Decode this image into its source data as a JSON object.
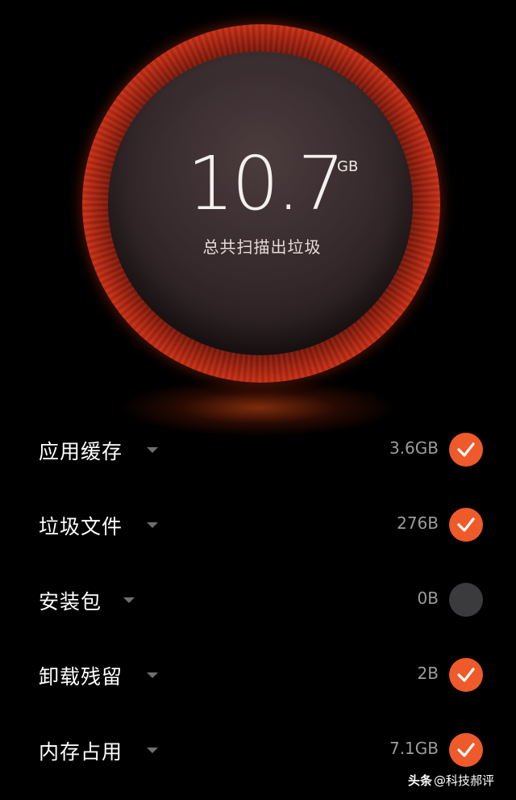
{
  "summary": {
    "value": "10.7",
    "unit": "GB",
    "caption": "总共扫描出垃圾"
  },
  "items": [
    {
      "label": "应用缓存",
      "size": "3.6GB",
      "checked": true
    },
    {
      "label": "垃圾文件",
      "size": "276B",
      "checked": true
    },
    {
      "label": "安装包",
      "size": "0B",
      "checked": false
    },
    {
      "label": "卸载残留",
      "size": "2B",
      "checked": true
    },
    {
      "label": "内存占用",
      "size": "7.1GB",
      "checked": true
    }
  ],
  "watermark": {
    "brand": "头条",
    "handle": "@科技郝评"
  },
  "colors": {
    "accent": "#ef5a2a",
    "ring": "#d23a18",
    "unchecked": "#3b3b3d",
    "muted_text": "#9c9c9c"
  }
}
